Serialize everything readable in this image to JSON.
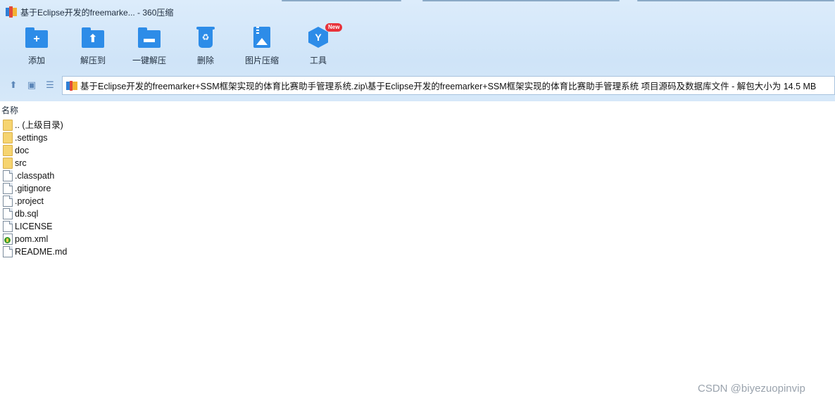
{
  "window": {
    "title": "基于Eclipse开发的freemarke... - 360压缩"
  },
  "toolbar": {
    "items": [
      {
        "label": "添加",
        "icon": "add-folder-icon",
        "glyph": "+"
      },
      {
        "label": "解压到",
        "icon": "extract-to-icon",
        "glyph": "⬆"
      },
      {
        "label": "一键解压",
        "icon": "one-click-extract-icon",
        "glyph": "▬"
      },
      {
        "label": "删除",
        "icon": "delete-icon",
        "glyph": "♻"
      },
      {
        "label": "图片压缩",
        "icon": "image-compress-icon",
        "glyph": ""
      },
      {
        "label": "工具",
        "icon": "tools-icon",
        "glyph": "Y",
        "badge": "New"
      }
    ]
  },
  "address": {
    "path": "基于Eclipse开发的freemarker+SSM框架实现的体育比赛助手管理系统.zip\\基于Eclipse开发的freemarker+SSM框架实现的体育比赛助手管理系统 项目源码及数据库文件 - 解包大小为 14.5 MB"
  },
  "list": {
    "column_name": "名称",
    "items": [
      {
        "name": ".. (上级目录)",
        "type": "folder"
      },
      {
        "name": ".settings",
        "type": "folder"
      },
      {
        "name": "doc",
        "type": "folder"
      },
      {
        "name": "src",
        "type": "folder"
      },
      {
        "name": ".classpath",
        "type": "file"
      },
      {
        "name": ".gitignore",
        "type": "file"
      },
      {
        "name": ".project",
        "type": "file"
      },
      {
        "name": "db.sql",
        "type": "file"
      },
      {
        "name": "LICENSE",
        "type": "file"
      },
      {
        "name": "pom.xml",
        "type": "xml"
      },
      {
        "name": "README.md",
        "type": "file"
      }
    ]
  },
  "watermark": "CSDN @biyezuopinvip",
  "colors": {
    "accent": "#2d8ce8",
    "header_bg": "#d6e8f9",
    "badge": "#e8323a",
    "folder": "#f6d470"
  }
}
